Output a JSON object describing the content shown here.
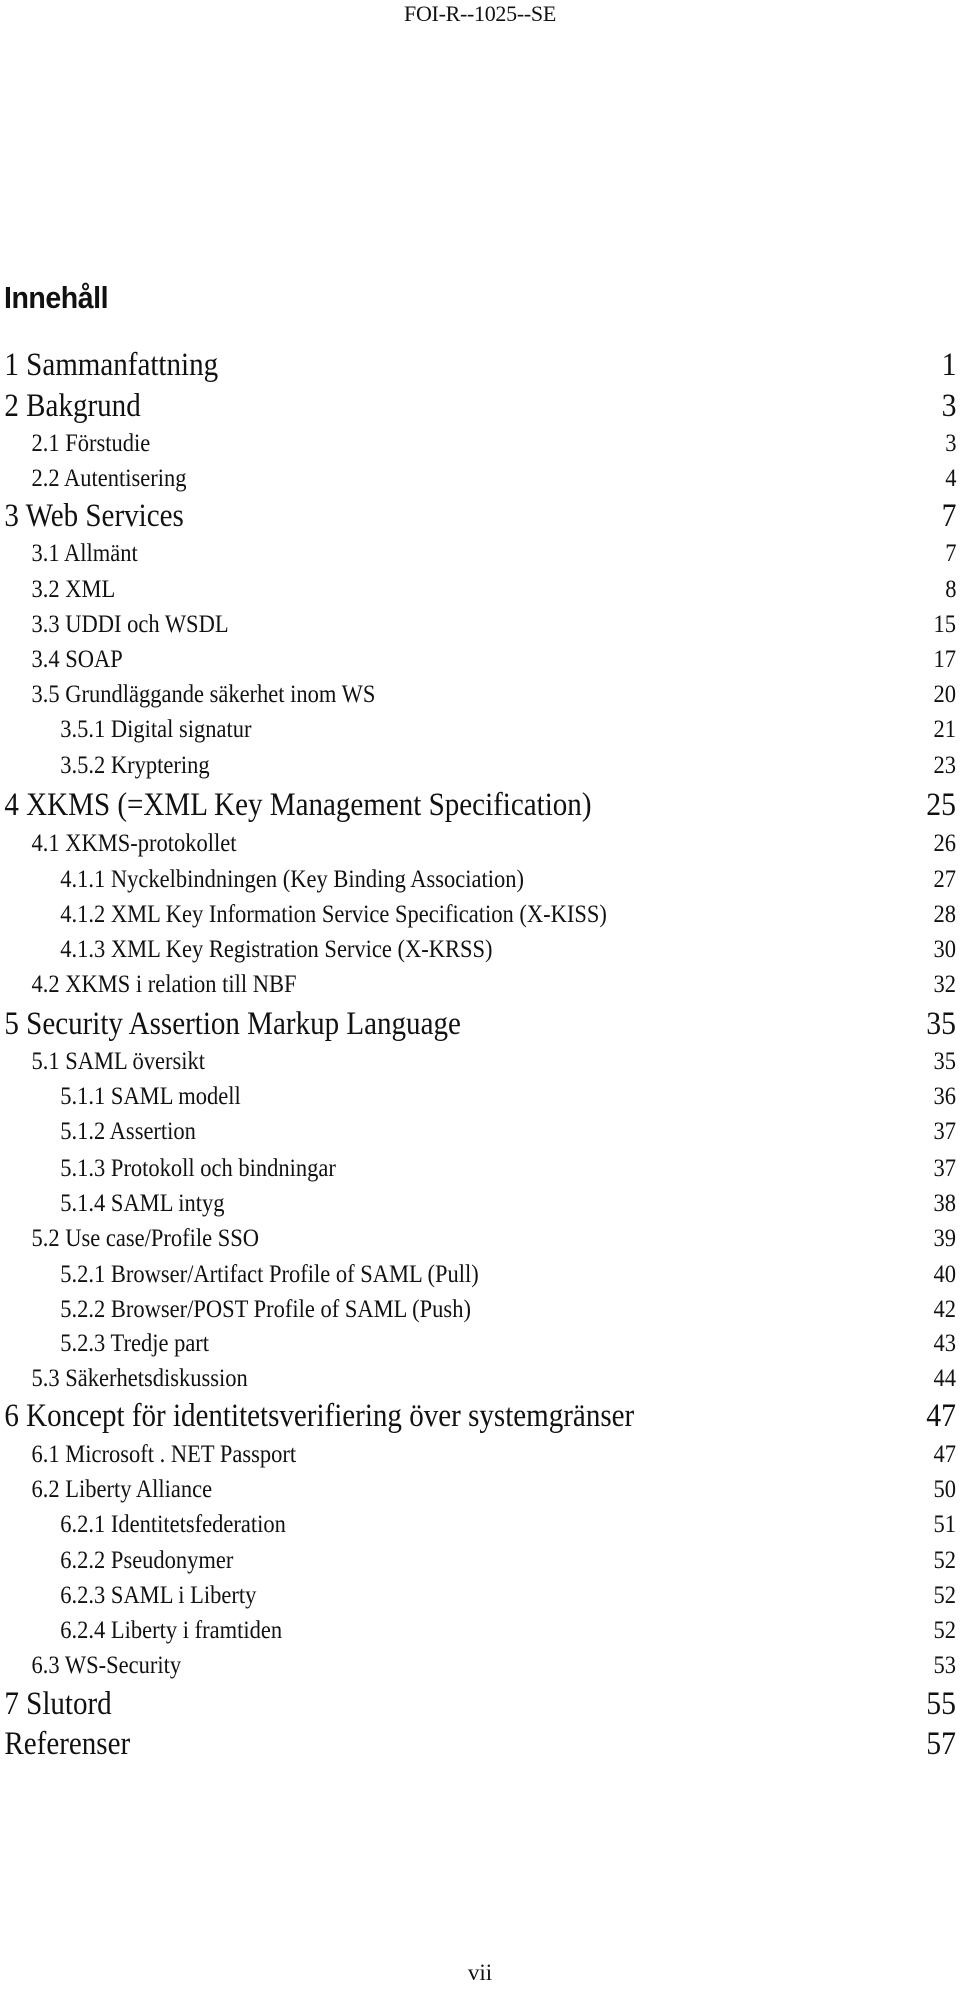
{
  "header": {
    "report_id": "FOI-R--1025--SE"
  },
  "toc": {
    "title": "Innehåll",
    "entries": [
      {
        "level": 1,
        "label": "1 Sammanfattning",
        "page": "1"
      },
      {
        "level": 1,
        "label": "2 Bakgrund",
        "page": "3"
      },
      {
        "level": 2,
        "label": "2.1 Förstudie",
        "page": "3"
      },
      {
        "level": 2,
        "label": "2.2 Autentisering",
        "page": "4"
      },
      {
        "level": 1,
        "label": "3 Web Services",
        "page": "7"
      },
      {
        "level": 2,
        "label": "3.1 Allmänt",
        "page": "7"
      },
      {
        "level": 2,
        "label": "3.2 XML",
        "page": "8"
      },
      {
        "level": 2,
        "label": "3.3 UDDI och WSDL",
        "page": "15"
      },
      {
        "level": 2,
        "label": "3.4 SOAP",
        "page": "17"
      },
      {
        "level": 2,
        "label": "3.5 Grundläggande säkerhet inom WS",
        "page": "20"
      },
      {
        "level": 3,
        "label": "3.5.1 Digital signatur",
        "page": "21"
      },
      {
        "level": 3,
        "label": "3.5.2 Kryptering",
        "page": "23"
      },
      {
        "level": 1,
        "label": "4 XKMS (=XML Key Management Specification)",
        "page": "25"
      },
      {
        "level": 2,
        "label": "4.1 XKMS-protokollet",
        "page": "26"
      },
      {
        "level": 3,
        "label": "4.1.1 Nyckelbindningen (Key Binding Association)",
        "page": "27"
      },
      {
        "level": 3,
        "label": "4.1.2 XML Key Information Service Specification (X-KISS)",
        "page": "28"
      },
      {
        "level": 3,
        "label": "4.1.3 XML Key Registration Service (X-KRSS)",
        "page": "30"
      },
      {
        "level": 2,
        "label": "4.2 XKMS i relation till NBF",
        "page": "32"
      },
      {
        "level": 1,
        "label": "5 Security Assertion Markup Language",
        "page": "35"
      },
      {
        "level": 2,
        "label": "5.1 SAML översikt",
        "page": "35"
      },
      {
        "level": 3,
        "label": "5.1.1 SAML modell",
        "page": "36"
      },
      {
        "level": 3,
        "label": "5.1.2 Assertion",
        "page": "37"
      },
      {
        "level": 3,
        "label": "5.1.3 Protokoll och bindningar",
        "page": "37"
      },
      {
        "level": 3,
        "label": "5.1.4 SAML intyg",
        "page": "38"
      },
      {
        "level": 2,
        "label": "5.2 Use case/Profile SSO",
        "page": "39"
      },
      {
        "level": 3,
        "label": "5.2.1 Browser/Artifact Profile of SAML (Pull)",
        "page": "40"
      },
      {
        "level": 3,
        "label": "5.2.2 Browser/POST Profile of SAML (Push)",
        "page": "42"
      },
      {
        "level": 3,
        "label": "5.2.3 Tredje part",
        "page": "43"
      },
      {
        "level": 2,
        "label": "5.3 Säkerhetsdiskussion",
        "page": "44"
      },
      {
        "level": 1,
        "label": "6 Koncept för identitetsverifiering över systemgränser",
        "page": "47"
      },
      {
        "level": 2,
        "label": "6.1 Microsoft . NET Passport",
        "page": "47"
      },
      {
        "level": 2,
        "label": "6.2 Liberty Alliance",
        "page": "50"
      },
      {
        "level": 3,
        "label": "6.2.1 Identitetsfederation",
        "page": "51"
      },
      {
        "level": 3,
        "label": "6.2.2 Pseudonymer",
        "page": "52"
      },
      {
        "level": 3,
        "label": "6.2.3 SAML i Liberty",
        "page": "52"
      },
      {
        "level": 3,
        "label": "6.2.4 Liberty i framtiden",
        "page": "52"
      },
      {
        "level": 2,
        "label": "6.3 WS-Security",
        "page": "53"
      },
      {
        "level": 1,
        "label": "7 Slutord",
        "page": "55"
      },
      {
        "level": 1,
        "label": "Referenser",
        "page": "57"
      }
    ]
  },
  "footer": {
    "page_number": "vii"
  }
}
